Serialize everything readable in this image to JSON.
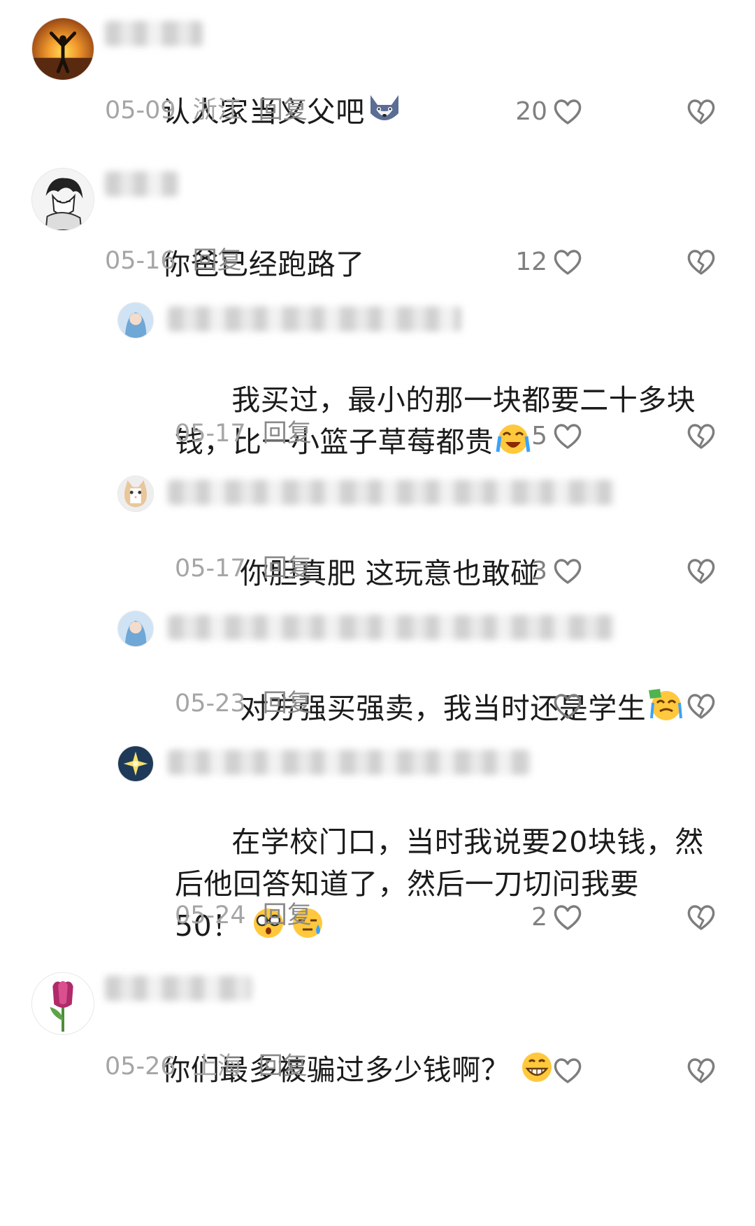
{
  "comments": [
    {
      "username": "",
      "text": "认人家当义父吧",
      "date": "05-09",
      "location": "浙江",
      "reply_label": "回复",
      "likes": "20",
      "emojis": [
        "wolf-doge-emoji"
      ]
    },
    {
      "username": "",
      "text": "你爸已经跑路了",
      "date": "05-16",
      "location": "",
      "reply_label": "回复",
      "likes": "12",
      "emojis": []
    },
    {
      "username": "",
      "text": "我买过，最小的那一块都要二十多块\n钱，比一小篮子草莓都贵",
      "date": "05-17",
      "location": "",
      "reply_label": "回复",
      "likes": "5",
      "emojis": [
        "loud-crying-emoji"
      ]
    },
    {
      "username": "",
      "text": "你胆真肥 这玩意也敢碰",
      "date": "05-17",
      "location": "",
      "reply_label": "回复",
      "likes": "3",
      "emojis": []
    },
    {
      "username": "",
      "text": "对方强买强卖，我当时还是学生",
      "date": "05-23",
      "location": "",
      "reply_label": "回复",
      "likes": "",
      "emojis": [
        "crying-with-money-emoji"
      ]
    },
    {
      "username": "",
      "text": "在学校门口，当时我说要20块钱，然\n后他回答知道了，然后一刀切问我要\n50！",
      "date": "05-24",
      "location": "",
      "reply_label": "回复",
      "likes": "2",
      "emojis": [
        "shocked-glasses-emoji",
        "sweat-speechless-emoji"
      ]
    },
    {
      "username": "",
      "text": "你们最多被骗过多少钱啊？",
      "date": "05-26",
      "location": "上海",
      "reply_label": "回复",
      "likes": "",
      "emojis": [
        "grinning-emoji"
      ]
    }
  ],
  "colors": {
    "text": "#1b1b1b",
    "meta": "#a5a5a5",
    "icon_stroke": "#7d7d7d"
  }
}
